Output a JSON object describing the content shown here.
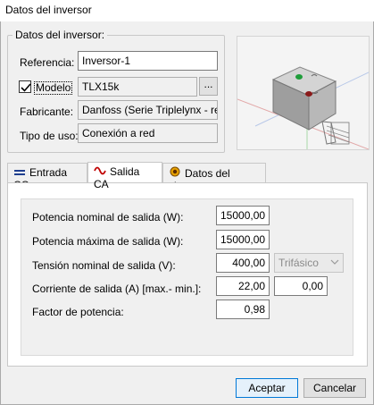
{
  "window": {
    "title": "Datos del inversor"
  },
  "group": {
    "legend": "Datos del inversor:",
    "referencia": {
      "label": "Referencia:",
      "value": "Inversor-1"
    },
    "modelo": {
      "label": "Modelo",
      "checked": true,
      "value": "TLX15k",
      "browse_label": "..."
    },
    "fabricante": {
      "label": "Fabricante:",
      "value": "Danfoss (Serie Triplelynx - red)"
    },
    "tipo_uso": {
      "label": "Tipo de uso:",
      "value": "Conexión a red"
    }
  },
  "tabs": [
    {
      "label": "Entrada CC",
      "icon": "dc-icon",
      "active": false
    },
    {
      "label": "Salida CA",
      "icon": "ac-wave-icon",
      "active": true
    },
    {
      "label": "Datos del sistema",
      "icon": "system-icon",
      "active": false
    }
  ],
  "salida_ca": {
    "potencia_nominal": {
      "label": "Potencia nominal de salida (W):",
      "value": "15000,00"
    },
    "potencia_maxima": {
      "label": "Potencia máxima de salida (W):",
      "value": "15000,00"
    },
    "tension_nominal": {
      "label": "Tensión nominal de salida (V):",
      "value": "400,00",
      "phase_option": "Trifásico"
    },
    "corriente": {
      "label": "Corriente de salida (A) [max.- min.]:",
      "max": "22,00",
      "min": "0,00"
    },
    "factor_potencia": {
      "label": "Factor de potencia:",
      "value": "0,98"
    }
  },
  "buttons": {
    "accept": "Aceptar",
    "cancel": "Cancelar"
  },
  "colors": {
    "accent": "#0078d7",
    "ac_wave": "#c00000",
    "dc_icon": "#1f3f8f"
  }
}
